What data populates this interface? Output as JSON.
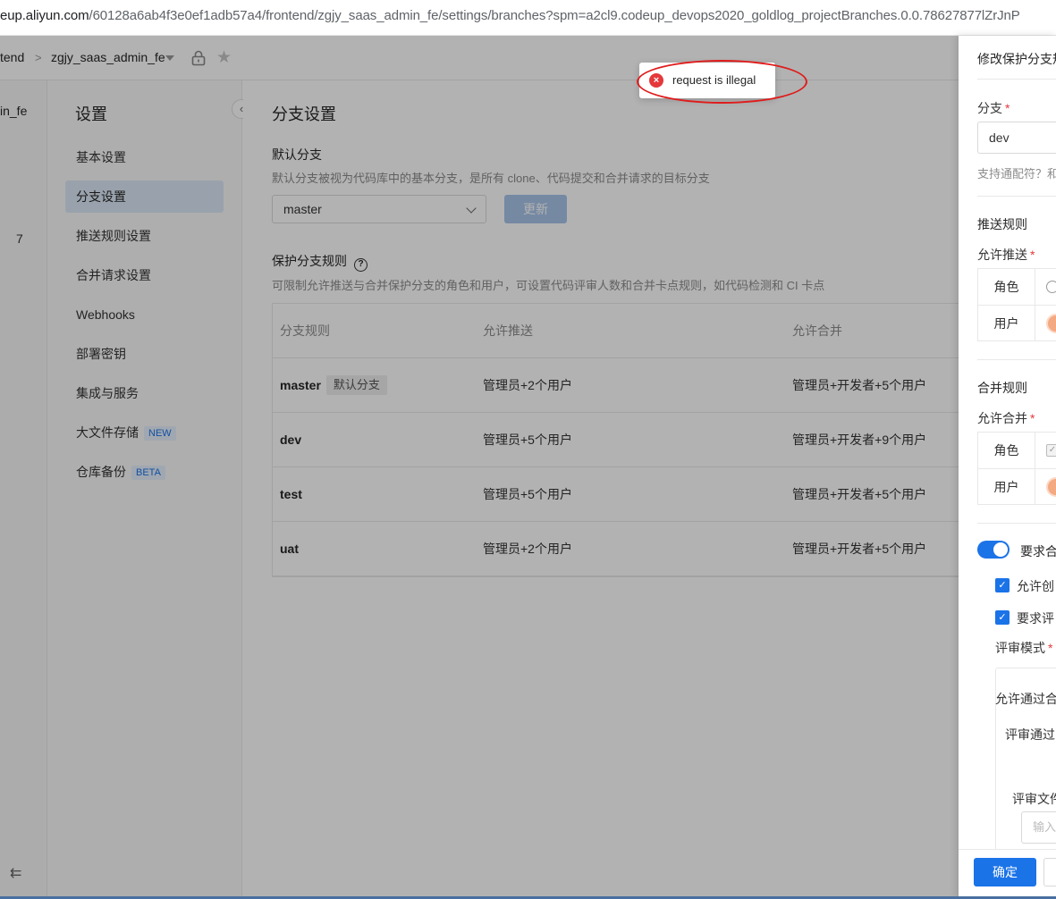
{
  "browser": {
    "url_host": "eup.aliyun.com",
    "url_path": "/60128a6ab4f3e0ef1adb57a4/frontend/zgjy_saas_admin_fe/settings/branches?spm=a2cl9.codeup_devops2020_goldlog_projectBranches.0.0.78627877lZrJnP"
  },
  "topbar": {
    "crumb_group": "tend",
    "crumb_sep": ">",
    "crumb_repo": "zgjy_saas_admin_fe"
  },
  "leftrail": {
    "project_label": "in_fe",
    "number": "7",
    "collapse_icon": "⇇"
  },
  "sidebar": {
    "title": "设置",
    "items": [
      {
        "label": "基本设置"
      },
      {
        "label": "分支设置"
      },
      {
        "label": "推送规则设置"
      },
      {
        "label": "合并请求设置"
      },
      {
        "label": "Webhooks"
      },
      {
        "label": "部署密钥"
      },
      {
        "label": "集成与服务"
      },
      {
        "label": "大文件存储",
        "tag": "NEW"
      },
      {
        "label": "仓库备份",
        "tag": "BETA"
      }
    ]
  },
  "main": {
    "title": "分支设置",
    "default_branch": {
      "heading": "默认分支",
      "desc": "默认分支被视为代码库中的基本分支，是所有 clone、代码提交和合并请求的目标分支",
      "selected": "master",
      "update_label": "更新"
    },
    "protect": {
      "heading": "保护分支规则",
      "desc": "可限制允许推送与合并保护分支的角色和用户，可设置代码评审人数和合并卡点规则，如代码检测和 CI 卡点"
    },
    "table": {
      "headers": [
        "分支规则",
        "允许推送",
        "允许合并"
      ],
      "default_tag": "默认分支",
      "rows": [
        {
          "branch": "master",
          "push": "管理员+2个用户",
          "merge": "管理员+开发者+5个用户"
        },
        {
          "branch": "dev",
          "push": "管理员+5个用户",
          "merge": "管理员+开发者+9个用户"
        },
        {
          "branch": "test",
          "push": "管理员+5个用户",
          "merge": "管理员+开发者+5个用户"
        },
        {
          "branch": "uat",
          "push": "管理员+2个用户",
          "merge": "管理员+开发者+5个用户"
        }
      ]
    }
  },
  "toast": {
    "message": "request is illegal"
  },
  "drawer": {
    "title": "修改保护分支规",
    "branch_label": "分支",
    "required_mark": "*",
    "branch_value": "dev",
    "branch_hint": "支持通配符？和",
    "push_section": "推送规则",
    "allow_push_label": "允许推送",
    "role_label": "角色",
    "user_label": "用户",
    "merge_section": "合并规则",
    "allow_merge_label": "允许合并",
    "switch_label": "要求合",
    "check1_label": "允许创",
    "check2_label": "要求评",
    "review_mode_label": "评审模式",
    "allow_pass_label": "允许通过合",
    "review_pass_label": "评审通过",
    "review_file_label": "评审文件",
    "input_placeholder": "输入",
    "ok_label": "确定"
  }
}
